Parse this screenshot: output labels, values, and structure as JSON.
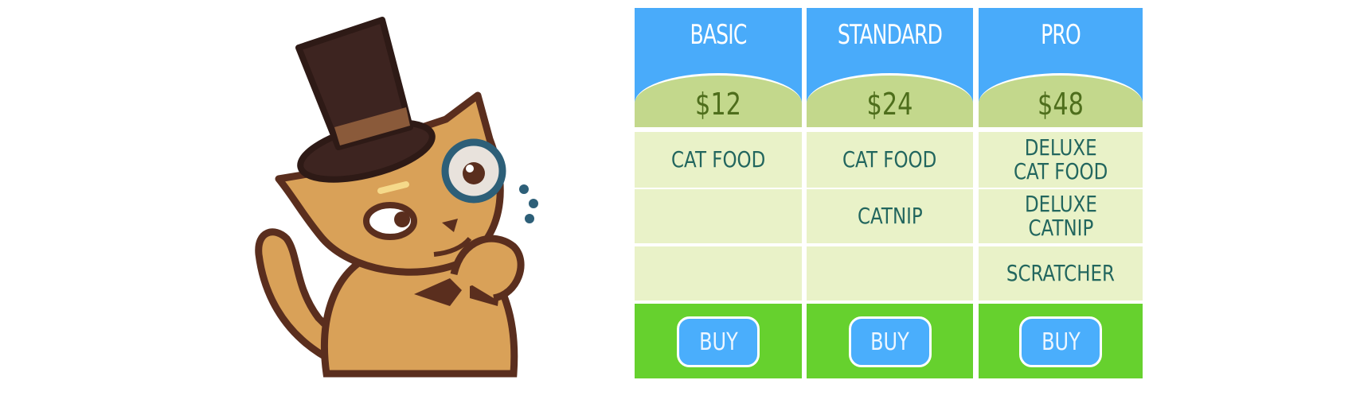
{
  "illustration": {
    "subject": "cat wearing top hat and monocle",
    "colors": {
      "fur": "#d9a158",
      "outline": "#5a2e1e",
      "hat": "#3d2420",
      "hat_band": "#8a5a3a",
      "monocle": "#2d5f78"
    }
  },
  "pricing": {
    "plans": [
      {
        "name": "BASIC",
        "price": "$12",
        "features": [
          "CAT FOOD",
          "",
          ""
        ],
        "cta": "BUY"
      },
      {
        "name": "STANDARD",
        "price": "$24",
        "features": [
          "CAT FOOD",
          "CATNIP",
          ""
        ],
        "cta": "BUY"
      },
      {
        "name": "PRO",
        "price": "$48",
        "features": [
          "DELUXE\nCAT FOOD",
          "DELUXE\nCATNIP",
          "SCRATCHER"
        ],
        "cta": "BUY"
      }
    ],
    "colors": {
      "header": "#49abfa",
      "price_bg": "#c3d88c",
      "price_text": "#4e6e1c",
      "feature_bg": "#e9f2c8",
      "feature_text": "#22665e",
      "buy_row": "#66d12e",
      "buy_button": "#4aaefc"
    }
  }
}
